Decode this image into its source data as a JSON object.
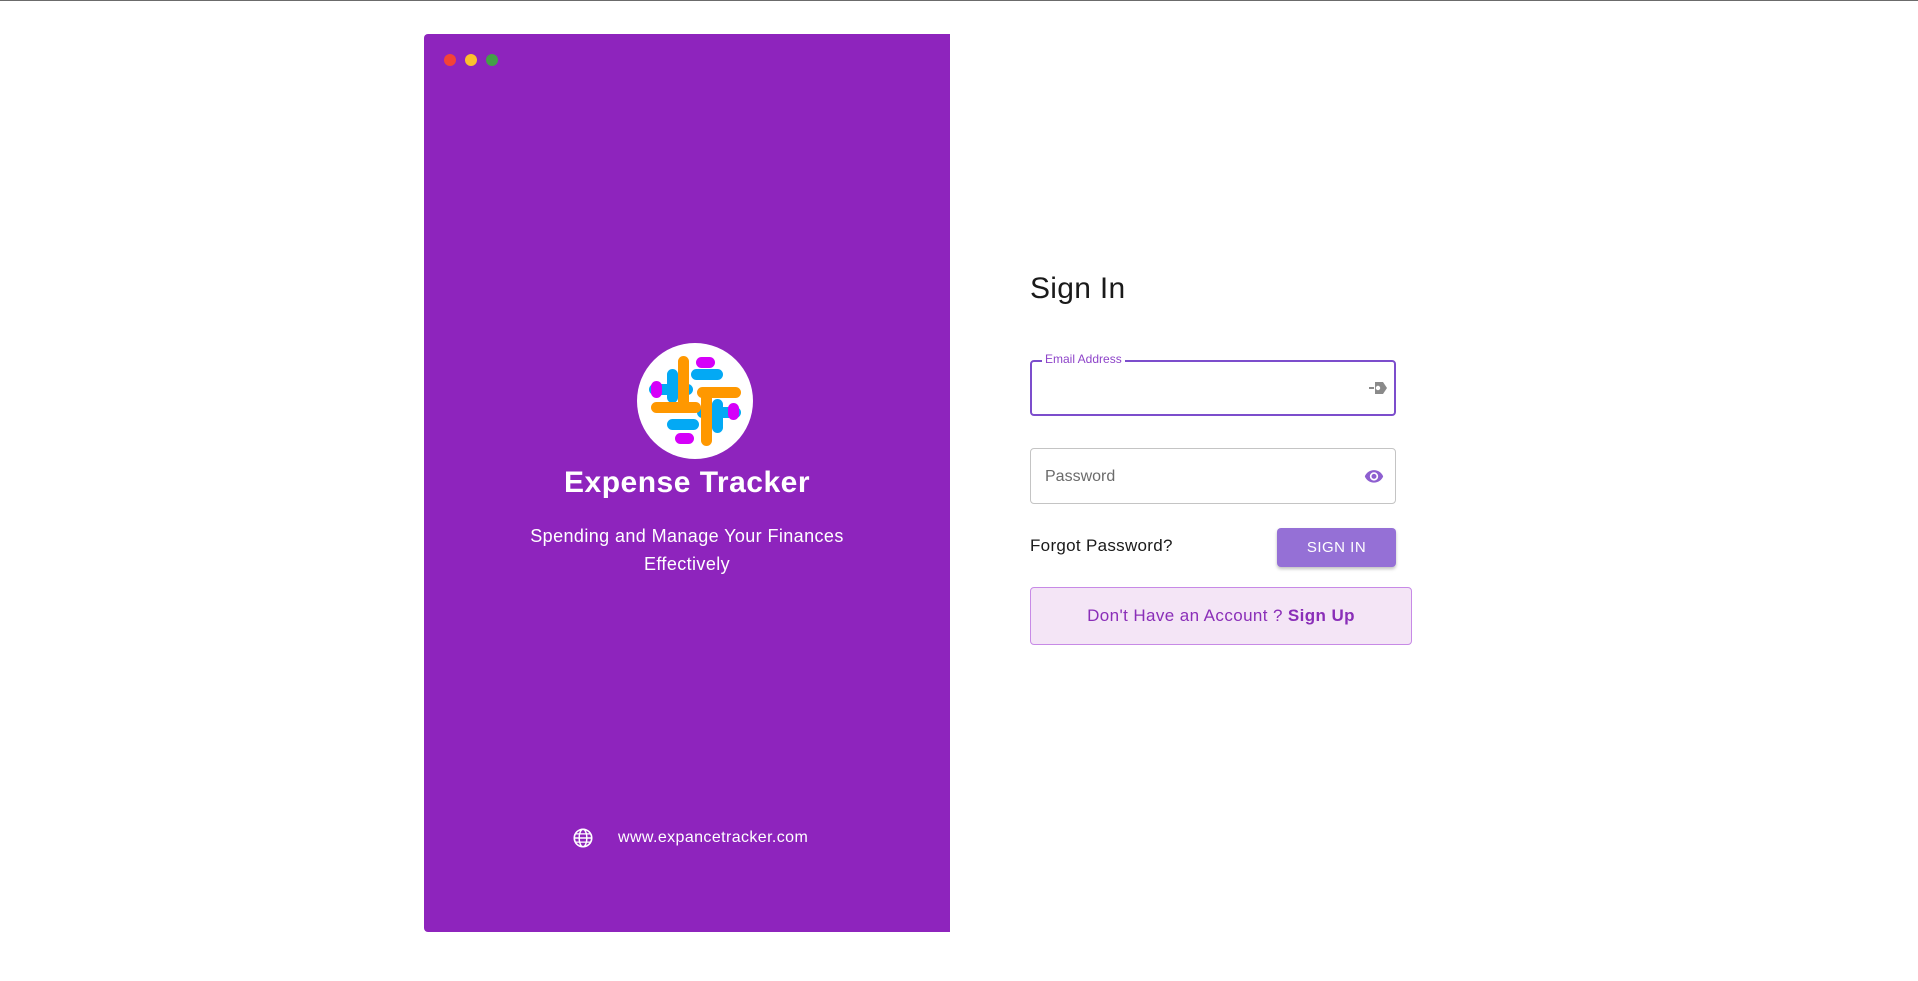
{
  "brand": {
    "title": "Expense Tracker",
    "tagline": "Spending and Manage Your Finances Effectively",
    "website": "www.expancetracker.com",
    "panel_color": "#8e24bd",
    "window_dots": [
      "#f44336",
      "#fbc02d",
      "#43a047"
    ],
    "logo_colors": [
      "#ff9800",
      "#03a9f4",
      "#d500f9"
    ]
  },
  "form": {
    "title": "Sign In",
    "email": {
      "label": "Email Address",
      "value": ""
    },
    "password": {
      "placeholder": "Password",
      "value": ""
    },
    "forgot_label": "Forgot Password?",
    "submit_label": "SIGN IN",
    "signup_prompt": "Don't Have an Account ?",
    "signup_link": "Sign Up"
  },
  "icons": {
    "email_trailing": "autofill-key-icon",
    "password_trailing": "eye-icon",
    "website": "globe-icon"
  }
}
